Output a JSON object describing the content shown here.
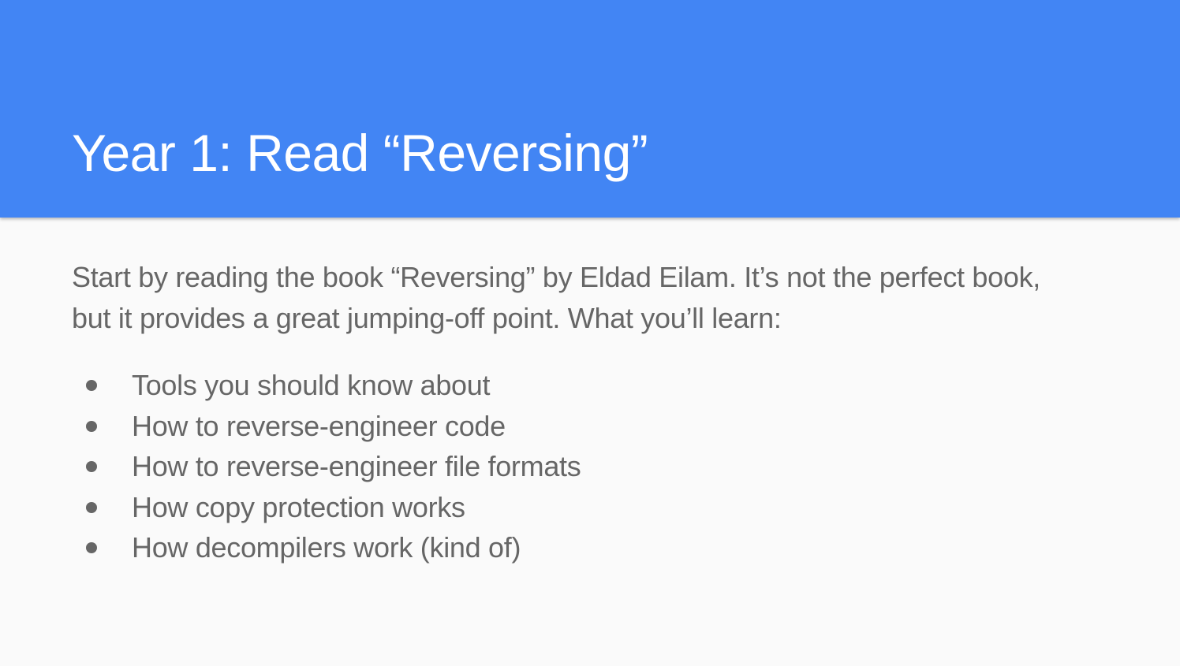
{
  "slide": {
    "title": "Year 1: Read “Reversing”",
    "intro_line1": "Start by reading the book “Reversing” by Eldad Eilam.  It’s not the perfect book,",
    "intro_line2": "but it provides a great jumping-off point.  What you’ll learn:",
    "bullets": [
      "Tools you should know about",
      "How to reverse-engineer code",
      "How to reverse-engineer file formats",
      "How copy protection works",
      "How decompilers work (kind of)"
    ]
  },
  "colors": {
    "header_background": "#4285f4",
    "slide_background": "#fafafa",
    "title_text": "#ffffff",
    "body_text": "#666666"
  }
}
